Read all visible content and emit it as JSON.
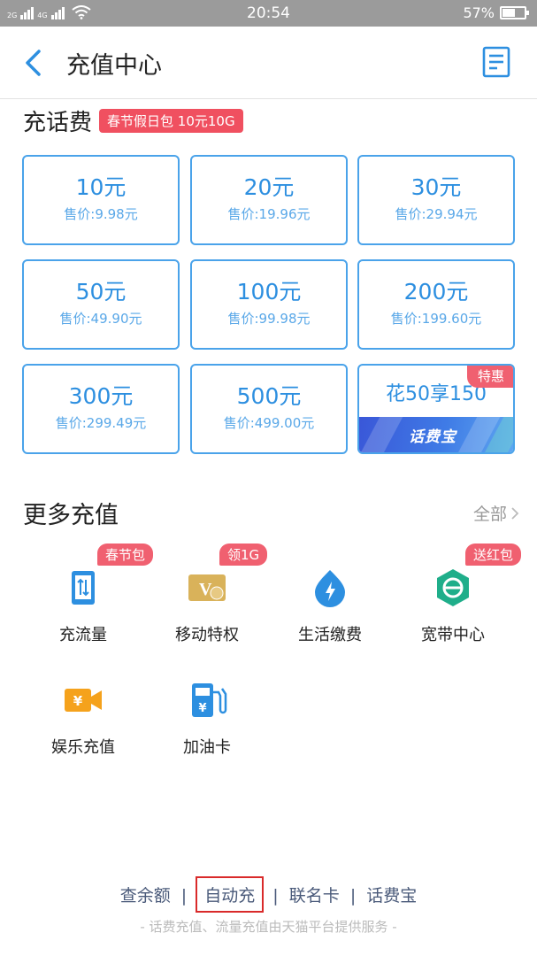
{
  "status_bar": {
    "signal1_tag": "2G",
    "signal2_tag": "4G",
    "time": "20:54",
    "battery_percent": "57%",
    "battery_level": 0.57
  },
  "header": {
    "title": "充值中心",
    "back_icon": "chevron-left-icon",
    "bill_icon": "bill-list-icon"
  },
  "recharge": {
    "title": "充话费",
    "promo_badge": "春节假日包 10元10G",
    "cards": [
      {
        "amount": "10元",
        "price": "售价:9.98元"
      },
      {
        "amount": "20元",
        "price": "售价:19.96元"
      },
      {
        "amount": "30元",
        "price": "售价:29.94元"
      },
      {
        "amount": "50元",
        "price": "售价:49.90元"
      },
      {
        "amount": "100元",
        "price": "售价:99.98元"
      },
      {
        "amount": "200元",
        "price": "售价:199.60元"
      },
      {
        "amount": "300元",
        "price": "售价:299.49元"
      },
      {
        "amount": "500元",
        "price": "售价:499.00元"
      }
    ],
    "special": {
      "badge": "特惠",
      "text": "花50享150",
      "banner_logo": "话费宝"
    }
  },
  "more": {
    "title": "更多充值",
    "all_label": "全部",
    "services": [
      {
        "label": "充流量",
        "badge": "春节包",
        "icon": "data-traffic-icon"
      },
      {
        "label": "移动特权",
        "badge": "领1G",
        "icon": "privilege-card-icon"
      },
      {
        "label": "生活缴费",
        "badge": "",
        "icon": "utility-drop-icon"
      },
      {
        "label": "宽带中心",
        "badge": "送红包",
        "icon": "broadband-icon"
      },
      {
        "label": "娱乐充值",
        "badge": "",
        "icon": "video-camera-icon"
      },
      {
        "label": "加油卡",
        "badge": "",
        "icon": "fuel-pump-icon"
      }
    ]
  },
  "footer": {
    "links": [
      "查余额",
      "自动充",
      "联名卡",
      "话费宝"
    ],
    "separator": "|",
    "note": "- 话费充值、流量充值由天猫平台提供服务 -"
  },
  "colors": {
    "accent": "#2d8fe0",
    "badge_red": "#f06070",
    "highlight_box": "#d92a2a"
  }
}
